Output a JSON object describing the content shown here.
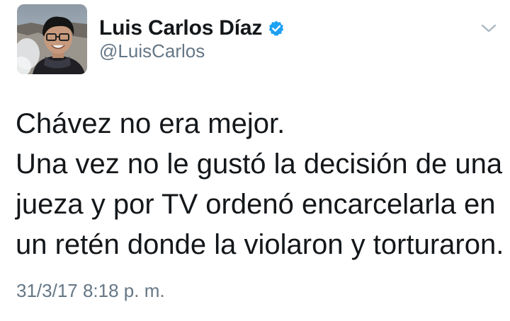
{
  "user": {
    "display_name": "Luis Carlos Díaz",
    "handle": "@LuisCarlos",
    "verified": true
  },
  "tweet": {
    "lines": [
      "Chávez no era mejor.",
      "Una vez no le gustó la decisión de una",
      "jueza y por TV ordenó encarcelarla en",
      "un retén donde la violaron y torturaron."
    ],
    "timestamp": "31/3/17 8:18 p. m."
  },
  "icons": {
    "verified": "verified-badge-icon",
    "menu": "chevron-down-icon"
  },
  "colors": {
    "verified_blue": "#1da1f2",
    "text": "#14171a",
    "secondary_text": "#657786",
    "chevron": "#aab8c2"
  }
}
